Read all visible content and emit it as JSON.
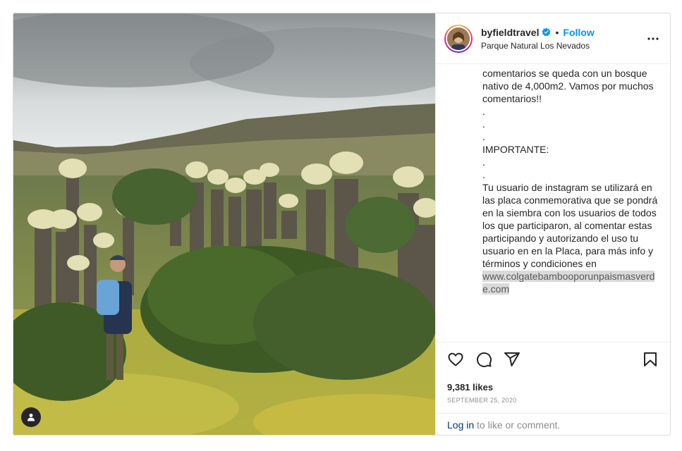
{
  "post": {
    "username": "byfieldtravel",
    "separator": "•",
    "follow_label": "Follow",
    "location": "Parque Natural Los Nevados",
    "caption_text": "comentarios se queda con un bosque nativo de 4,000m2. Vamos por muchos comentarios!!\n.\n.\n.\nIMPORTANTE:\n.\n.\nTu usuario de instagram se utilizará en las placa conmemorativa que se pondrá en la siembra con los usuarios de todos los que participaron, al comentar estas participando y autorizando el uso tu usuario en en la Placa, para más info y términos y condiciones en",
    "caption_link": "www.colgatebambooporunpaismasverde.com",
    "likes": "9,381 likes",
    "date": "SEPTEMBER 25, 2020",
    "login_link": "Log in",
    "login_suffix": " to like or comment."
  },
  "icons": {
    "verified": "verified-badge-icon",
    "more": "more-options-icon",
    "like": "heart-icon",
    "comment": "comment-icon",
    "share": "share-icon",
    "save": "bookmark-icon",
    "tag": "user-tag-icon"
  },
  "colors": {
    "accent": "#0095f6",
    "link_dark": "#00376b",
    "muted": "#8e8e8e",
    "border": "#dbdbdb"
  }
}
